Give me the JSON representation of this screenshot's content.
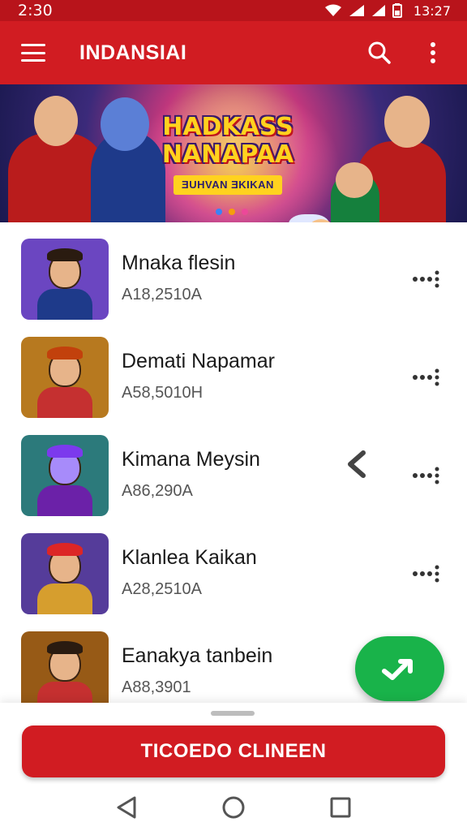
{
  "status_bar": {
    "time": "2:30",
    "clock_right": "13:27",
    "icons": [
      "wifi-icon",
      "signal-icon",
      "battery-icon"
    ]
  },
  "app_bar": {
    "title": "INDANSIAI",
    "icons": [
      "menu-icon",
      "search-icon",
      "more-vert-icon"
    ]
  },
  "banner": {
    "title_line1": "HADKASS",
    "title_line2": "NANAPAA",
    "subtitle": "ƎUHVAN ƎKIKAN",
    "dots": [
      "#3b82f6",
      "#f59e0b",
      "#ec4899"
    ]
  },
  "list": {
    "items": [
      {
        "title": "Mnaka flesin",
        "subtitle": "A18,2510A",
        "thumb_bg": "#6b46c1",
        "shirt": "#1e3a8a"
      },
      {
        "title": "Demati Napamar",
        "subtitle": "A58,5010H",
        "thumb_bg": "#b7791f",
        "shirt": "#c53030"
      },
      {
        "title": "Kimana Meysin",
        "subtitle": "A86,290A",
        "thumb_bg": "#2c7a7b",
        "shirt": "#6b21a8"
      },
      {
        "title": "Klanlea Kaikan",
        "subtitle": "A28,2510A",
        "thumb_bg": "#553c9a",
        "shirt": "#d69e2e"
      },
      {
        "title": "Eanakya tanbein",
        "subtitle": "A88,3901",
        "thumb_bg": "#975a16",
        "shirt": "#c53030"
      }
    ]
  },
  "fab": {
    "icon": "share-arrow-icon",
    "color": "#19b34a"
  },
  "cta": {
    "label": "TICOEDO CLINEEN"
  },
  "nav": {
    "icons": [
      "back-triangle-icon",
      "home-circle-icon",
      "recents-square-icon"
    ]
  },
  "colors": {
    "primary": "#d11c22",
    "status": "#b8141b",
    "fab": "#19b34a"
  }
}
